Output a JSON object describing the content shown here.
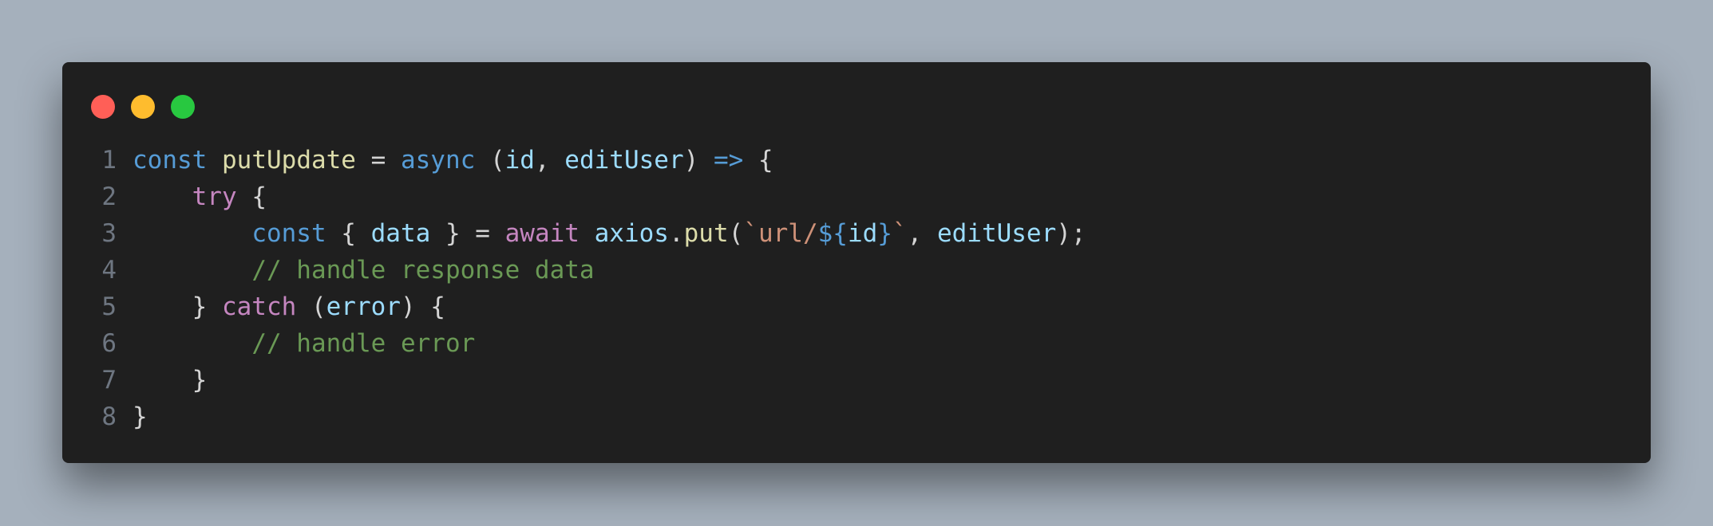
{
  "window": {
    "controls": [
      {
        "name": "close-dot",
        "color": "#ff5f57"
      },
      {
        "name": "minimize-dot",
        "color": "#febc2e"
      },
      {
        "name": "maximize-dot",
        "color": "#28c840"
      }
    ]
  },
  "colors": {
    "keyword_blue": "#569cd6",
    "keyword_purple": "#c586c0",
    "function": "#dcdcaa",
    "variable": "#9cdcfe",
    "string": "#ce9178",
    "comment": "#6a9955",
    "plain": "#d4d4d4"
  },
  "code": {
    "lines": [
      {
        "number": "1",
        "tokens": [
          {
            "text": "const",
            "color": "#569cd6"
          },
          {
            "text": " ",
            "color": "#d4d4d4"
          },
          {
            "text": "putUpdate",
            "color": "#dcdcaa"
          },
          {
            "text": " = ",
            "color": "#d4d4d4"
          },
          {
            "text": "async",
            "color": "#569cd6"
          },
          {
            "text": " (",
            "color": "#d4d4d4"
          },
          {
            "text": "id",
            "color": "#9cdcfe"
          },
          {
            "text": ", ",
            "color": "#d4d4d4"
          },
          {
            "text": "editUser",
            "color": "#9cdcfe"
          },
          {
            "text": ") ",
            "color": "#d4d4d4"
          },
          {
            "text": "=>",
            "color": "#569cd6"
          },
          {
            "text": " {",
            "color": "#d4d4d4"
          }
        ]
      },
      {
        "number": "2",
        "tokens": [
          {
            "text": "    ",
            "color": "#d4d4d4"
          },
          {
            "text": "try",
            "color": "#c586c0"
          },
          {
            "text": " {",
            "color": "#d4d4d4"
          }
        ]
      },
      {
        "number": "3",
        "tokens": [
          {
            "text": "        ",
            "color": "#d4d4d4"
          },
          {
            "text": "const",
            "color": "#569cd6"
          },
          {
            "text": " { ",
            "color": "#d4d4d4"
          },
          {
            "text": "data",
            "color": "#9cdcfe"
          },
          {
            "text": " } = ",
            "color": "#d4d4d4"
          },
          {
            "text": "await",
            "color": "#c586c0"
          },
          {
            "text": " ",
            "color": "#d4d4d4"
          },
          {
            "text": "axios",
            "color": "#9cdcfe"
          },
          {
            "text": ".",
            "color": "#d4d4d4"
          },
          {
            "text": "put",
            "color": "#dcdcaa"
          },
          {
            "text": "(",
            "color": "#d4d4d4"
          },
          {
            "text": "`url/",
            "color": "#ce9178"
          },
          {
            "text": "${",
            "color": "#569cd6"
          },
          {
            "text": "id",
            "color": "#9cdcfe"
          },
          {
            "text": "}",
            "color": "#569cd6"
          },
          {
            "text": "`",
            "color": "#ce9178"
          },
          {
            "text": ", ",
            "color": "#d4d4d4"
          },
          {
            "text": "editUser",
            "color": "#9cdcfe"
          },
          {
            "text": ");",
            "color": "#d4d4d4"
          }
        ]
      },
      {
        "number": "4",
        "tokens": [
          {
            "text": "        ",
            "color": "#d4d4d4"
          },
          {
            "text": "// handle response data",
            "color": "#6a9955"
          }
        ]
      },
      {
        "number": "5",
        "tokens": [
          {
            "text": "    } ",
            "color": "#d4d4d4"
          },
          {
            "text": "catch",
            "color": "#c586c0"
          },
          {
            "text": " (",
            "color": "#d4d4d4"
          },
          {
            "text": "error",
            "color": "#9cdcfe"
          },
          {
            "text": ") {",
            "color": "#d4d4d4"
          }
        ]
      },
      {
        "number": "6",
        "tokens": [
          {
            "text": "        ",
            "color": "#d4d4d4"
          },
          {
            "text": "// handle error",
            "color": "#6a9955"
          }
        ]
      },
      {
        "number": "7",
        "tokens": [
          {
            "text": "    }",
            "color": "#d4d4d4"
          }
        ]
      },
      {
        "number": "8",
        "tokens": [
          {
            "text": "}",
            "color": "#d4d4d4"
          }
        ]
      }
    ]
  }
}
